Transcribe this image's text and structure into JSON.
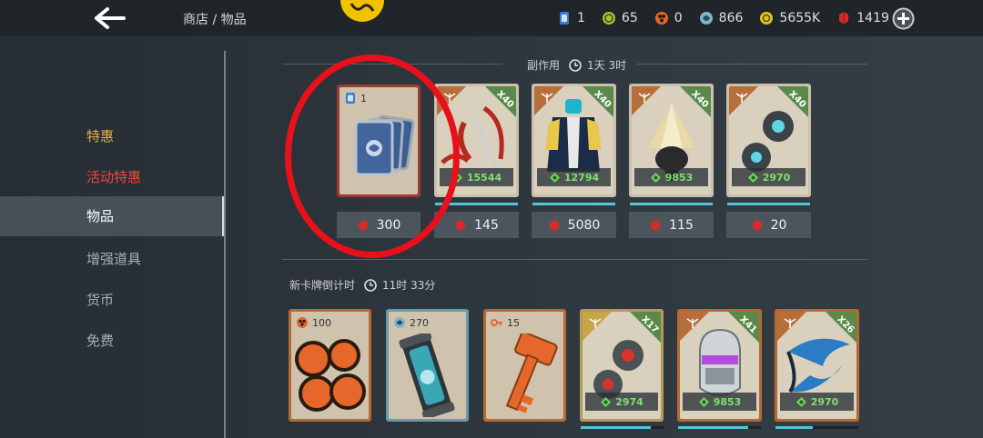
{
  "header": {
    "breadcrumb": "商店 / 物品",
    "currencies": [
      {
        "icon": "card-icon",
        "value": "1",
        "color": "#3a7bd5"
      },
      {
        "icon": "green-coin-icon",
        "value": "65",
        "color": "#a6c43a"
      },
      {
        "icon": "orange-seal-icon",
        "value": "0",
        "color": "#e6672c"
      },
      {
        "icon": "blue-orb-icon",
        "value": "866",
        "color": "#78b8c6"
      },
      {
        "icon": "gold-coin-icon",
        "value": "5655K",
        "color": "#e0c22a"
      },
      {
        "icon": "ruby-icon",
        "value": "1419",
        "color": "#d62b2b"
      }
    ]
  },
  "sidebar": {
    "items": [
      {
        "label": "特惠",
        "color": "#e5b042",
        "active": false
      },
      {
        "label": "活动特惠",
        "color": "#e84a3c",
        "active": false
      },
      {
        "label": "物品",
        "color": "#ffffff",
        "active": true
      },
      {
        "label": "增强道具",
        "color": "#a9b0b5",
        "active": false
      },
      {
        "label": "货币",
        "color": "#a9b0b5",
        "active": false
      },
      {
        "label": "免费",
        "color": "#a9b0b5",
        "active": false
      }
    ]
  },
  "section1": {
    "title": "副作用",
    "timer": "1天 3时",
    "cards": [
      {
        "kind": "cards",
        "count": "1",
        "price": "300",
        "frame": "red"
      },
      {
        "kind": "scythe",
        "badge": "X40",
        "stat": "15544",
        "price": "145",
        "frame": "tan",
        "progress": 1.0
      },
      {
        "kind": "armor",
        "badge": "X40",
        "stat": "12794",
        "price": "5080",
        "frame": "tan",
        "progress": 1.0
      },
      {
        "kind": "hat",
        "badge": "X40",
        "stat": "9853",
        "price": "115",
        "frame": "tan",
        "progress": 1.0
      },
      {
        "kind": "orbs",
        "badge": "X40",
        "stat": "2970",
        "price": "20",
        "frame": "tan",
        "progress": 1.0
      }
    ]
  },
  "section2": {
    "title": "新卡牌倒计时",
    "timer": "11时 33分",
    "cards": [
      {
        "kind": "seals",
        "count": "100",
        "frame": "orange"
      },
      {
        "kind": "capsule",
        "count": "270",
        "frame": "teal"
      },
      {
        "kind": "key",
        "count": "15",
        "frame": "orange"
      },
      {
        "kind": "orbs",
        "badge": "X17",
        "stat": "2974",
        "frame": "gold",
        "progress": 0.85
      },
      {
        "kind": "helmet",
        "badge": "X41",
        "stat": "9853",
        "frame": "orange",
        "progress": 0.85
      },
      {
        "kind": "emblem",
        "badge": "X26",
        "stat": "2970",
        "frame": "orange",
        "progress": 0.45
      }
    ]
  }
}
